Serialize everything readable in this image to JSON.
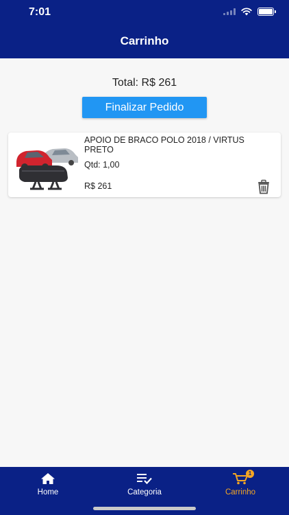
{
  "status_bar": {
    "time": "7:01"
  },
  "header": {
    "title": "Carrinho"
  },
  "cart": {
    "total_label": "Total: R$  261",
    "checkout_label": "Finalizar Pedido",
    "items": [
      {
        "name": "APOIO DE BRACO POLO 2018 / VIRTUS PRETO",
        "qty": "Qtd:  1,00",
        "price": "R$  261"
      }
    ]
  },
  "tabs": [
    {
      "label": "Home",
      "icon": "home-icon",
      "active": false
    },
    {
      "label": "Categoria",
      "icon": "category-list-icon",
      "active": false
    },
    {
      "label": "Carrinho",
      "icon": "cart-icon",
      "active": true,
      "badge": "1"
    }
  ],
  "colors": {
    "primary": "#0a2186",
    "accent": "#f5a623",
    "button": "#2196f3",
    "background": "#f7f7f7"
  }
}
